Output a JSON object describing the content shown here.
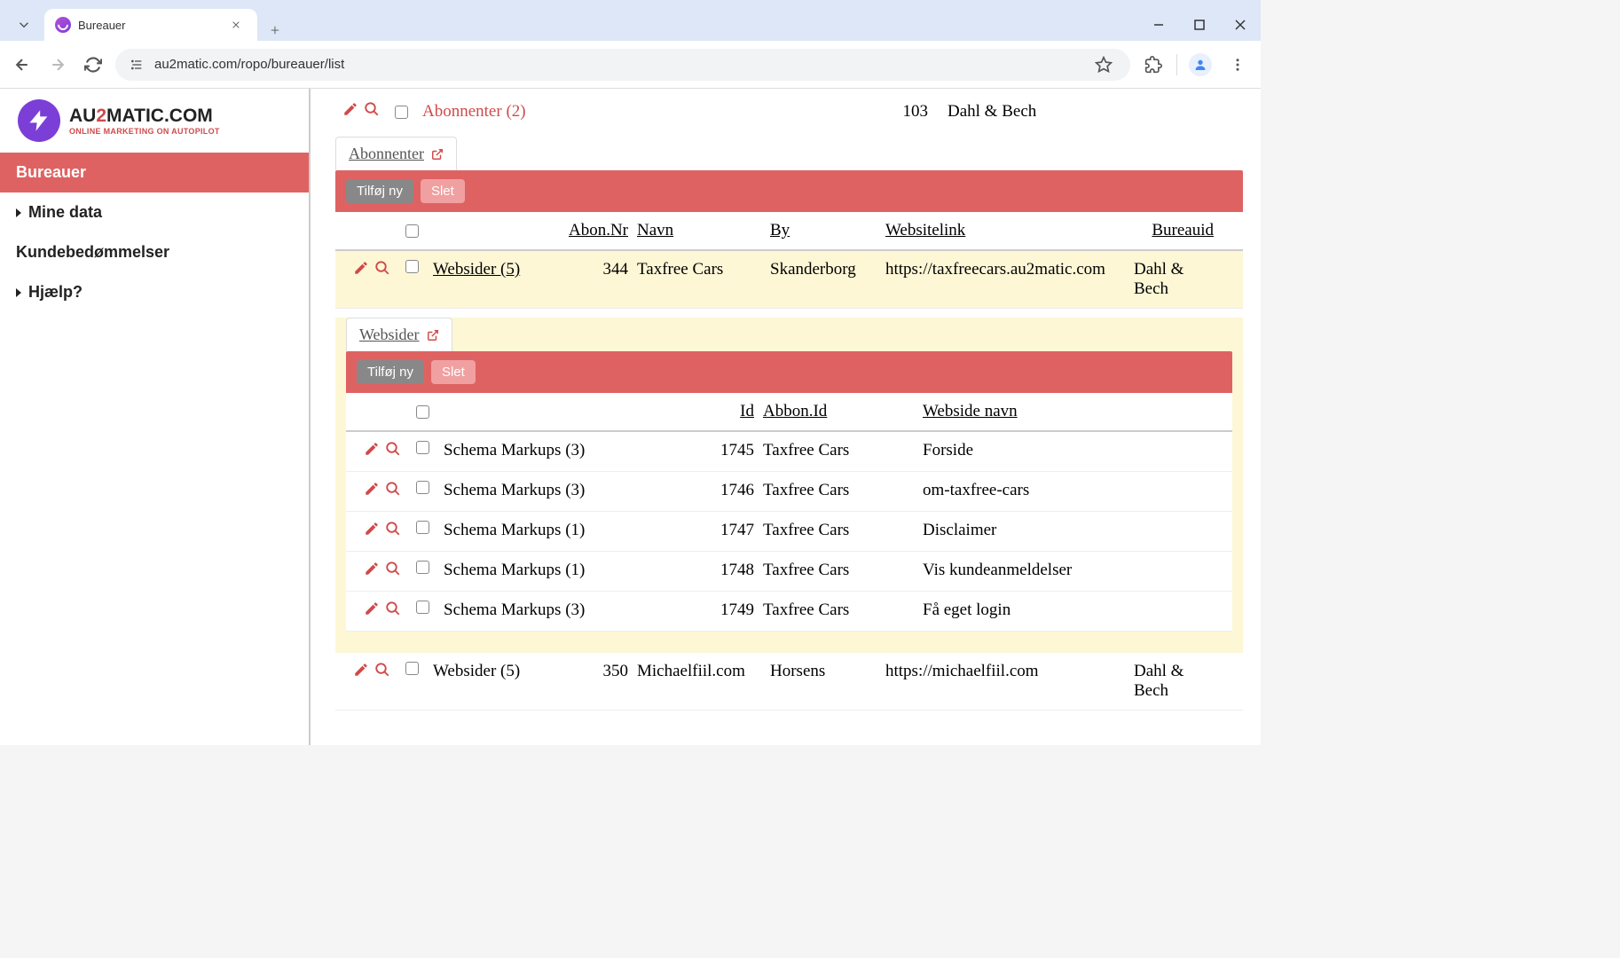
{
  "browser": {
    "tab_title": "Bureauer",
    "url": "au2matic.com/ropo/bureauer/list"
  },
  "logo": {
    "line1_a": "AU",
    "line1_b": "2",
    "line1_c": "MATIC.COM",
    "line2": "ONLINE MARKETING ON AUTOPILOT"
  },
  "sidebar": {
    "items": [
      {
        "label": "Bureauer",
        "active": true,
        "caret": false
      },
      {
        "label": "Mine data",
        "active": false,
        "caret": true
      },
      {
        "label": "Kundebedømmelser",
        "active": false,
        "caret": false
      },
      {
        "label": "Hjælp?",
        "active": false,
        "caret": true
      }
    ]
  },
  "abon_row": {
    "link": "Abonnenter (2)",
    "id": "103",
    "bureau": "Dahl & Bech"
  },
  "tab_abon": "Abonnenter",
  "buttons": {
    "add": "Tilføj ny",
    "del": "Slet"
  },
  "abon_table": {
    "headers": {
      "abonnr": "Abon.Nr",
      "navn": "Navn",
      "by": "By",
      "websitelink": "Websitelink",
      "bureauid": "Bureauid"
    },
    "rows": [
      {
        "link": "Websider (5)",
        "id": "344",
        "navn": "Taxfree Cars",
        "by": "Skanderborg",
        "weblink": "https://taxfreecars.au2matic.com",
        "bureau": "Dahl & Bech",
        "hi": true
      },
      {
        "link": "Websider (5)",
        "id": "350",
        "navn": "Michaelfiil.com",
        "by": "Horsens",
        "weblink": "https://michaelfiil.com",
        "bureau": "Dahl & Bech",
        "hi": false
      }
    ]
  },
  "tab_web": "Websider",
  "web_table": {
    "headers": {
      "id": "Id",
      "abbonid": "Abbon.Id",
      "webside": "Webside navn"
    },
    "rows": [
      {
        "link": "Schema Markups (3)",
        "id": "1745",
        "abbon": "Taxfree Cars",
        "name": "Forside"
      },
      {
        "link": "Schema Markups (3)",
        "id": "1746",
        "abbon": "Taxfree Cars",
        "name": "om-taxfree-cars"
      },
      {
        "link": "Schema Markups (1)",
        "id": "1747",
        "abbon": "Taxfree Cars",
        "name": "Disclaimer"
      },
      {
        "link": "Schema Markups (1)",
        "id": "1748",
        "abbon": "Taxfree Cars",
        "name": "Vis kundeanmeldelser"
      },
      {
        "link": "Schema Markups (3)",
        "id": "1749",
        "abbon": "Taxfree Cars",
        "name": "Få eget login"
      }
    ]
  }
}
